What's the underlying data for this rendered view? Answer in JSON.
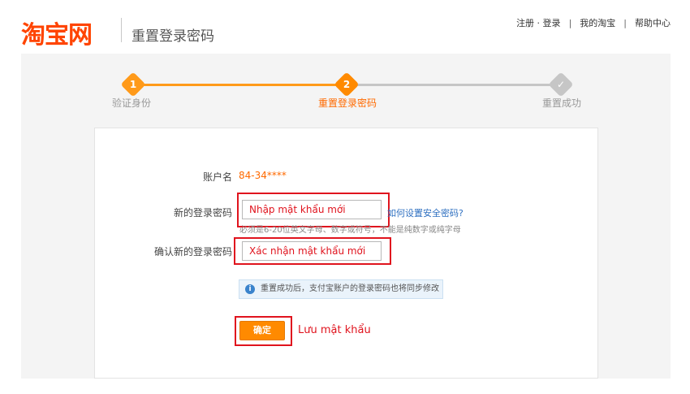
{
  "header": {
    "logo": "淘宝网",
    "page_title": "重置登录密码",
    "nav": [
      "注册 · 登录",
      "我的淘宝",
      "帮助中心"
    ]
  },
  "progress": {
    "steps": [
      {
        "number": "1",
        "label": "验证身份",
        "state": "done"
      },
      {
        "number": "2",
        "label": "重置登录密码",
        "state": "current"
      },
      {
        "number": "✓",
        "label": "重置成功",
        "state": "pending"
      }
    ]
  },
  "form": {
    "account_label": "账户名",
    "account_value": "84-34****",
    "new_password_label": "新的登录密码",
    "new_password_value": "Nhập mật khẩu mới",
    "password_help_link": "如何设置安全密码?",
    "password_hint": "必须是6-20位英文字母、数字或符号，不能是纯数字或纯字母",
    "confirm_password_label": "确认新的登录密码",
    "confirm_password_value": "Xác nhận mật khẩu mới",
    "notice": "重置成功后，支付宝账户的登录密码也将同步修改",
    "notice_icon": "i",
    "submit_label": "确定",
    "submit_annotation": "Lưu mật khẩu"
  },
  "colors": {
    "brand": "#ff4400",
    "accent": "#ff9a1a",
    "annotation": "#e0141e",
    "link": "#2e6fc0"
  }
}
